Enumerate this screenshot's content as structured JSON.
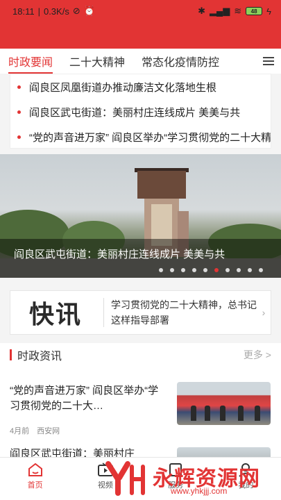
{
  "status_bar": {
    "time": "18:11",
    "speed": "0.3K/s",
    "battery": "48"
  },
  "colors": {
    "accent": "#e23434",
    "header_bg": "#e23434"
  },
  "tabs": [
    {
      "label": "时政要闻",
      "active": true
    },
    {
      "label": "二十大精神",
      "active": false
    },
    {
      "label": "常态化疫情防控",
      "active": false
    }
  ],
  "headlines": [
    "阎良区凤凰街道办推动廉洁文化落地生根",
    "阎良区武屯街道：美丽村庄连线成片  美美与共",
    "“党的声音进万家”  阎良区举办“学习贯彻党的二十大精神”"
  ],
  "banner": {
    "caption": "阎良区武屯街道：美丽村庄连线成片  美美与共",
    "dot_count": 10,
    "active_dot": 5
  },
  "kuaixun": {
    "logo": "快讯",
    "text": "学习贯彻党的二十大精神，总书记这样指导部署"
  },
  "section": {
    "title": "时政资讯",
    "more": "更多 >"
  },
  "news": [
    {
      "title": "“党的声音进万家”  阎良区举办“学习贯彻党的二十大…",
      "time": "4月前",
      "source": "西安网"
    },
    {
      "title": "阎良区武屯街道：美丽村庄"
    }
  ],
  "bottom_nav": [
    {
      "label": "首页",
      "icon": "home-icon",
      "active": true
    },
    {
      "label": "视频",
      "icon": "video-icon",
      "active": false
    },
    {
      "label": "服务",
      "icon": "service-icon",
      "active": false
    },
    {
      "label": "我的",
      "icon": "profile-icon",
      "active": false
    }
  ],
  "watermark": {
    "text": "永辉资源网",
    "url": "www.yhkjjj.com"
  }
}
